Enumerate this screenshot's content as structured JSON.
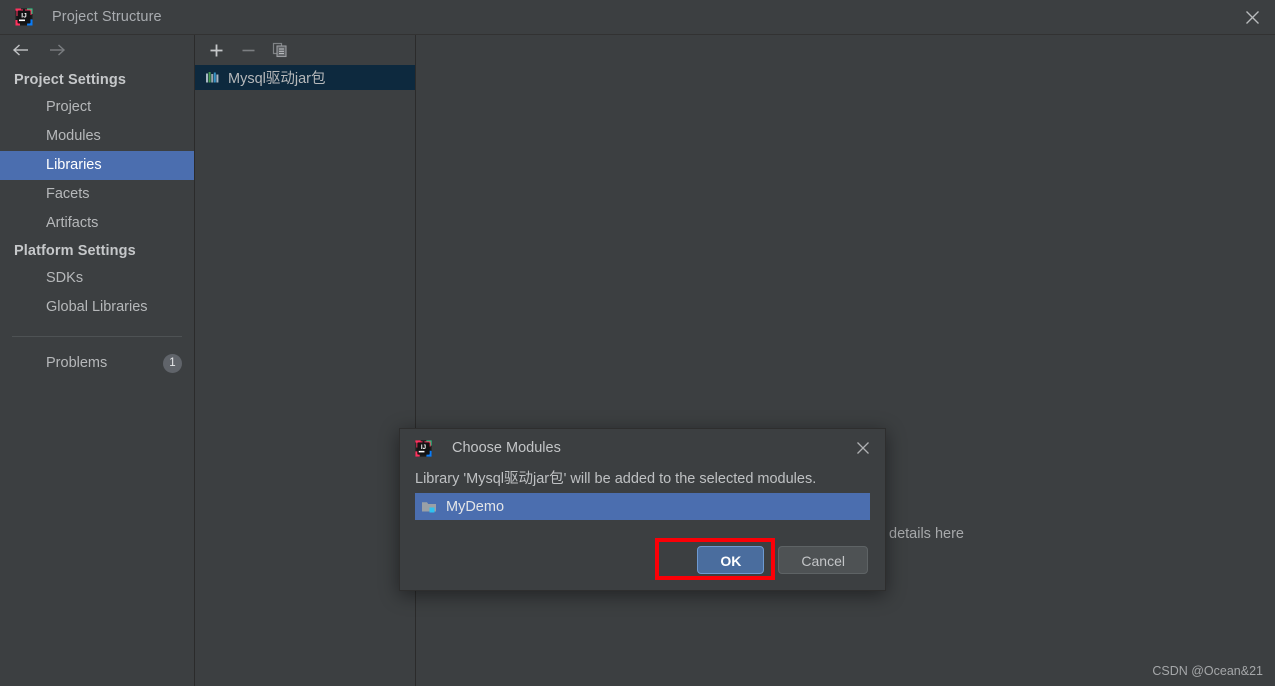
{
  "window": {
    "title": "Project Structure",
    "close_icon": "close-icon",
    "app_icon": "intellij-idea-logo"
  },
  "nav": {
    "back_icon": "arrow-left-icon",
    "forward_icon": "arrow-right-icon"
  },
  "sidebar": {
    "groups": [
      {
        "header": "Project Settings",
        "items": [
          {
            "label": "Project",
            "selected": false
          },
          {
            "label": "Modules",
            "selected": false
          },
          {
            "label": "Libraries",
            "selected": true
          },
          {
            "label": "Facets",
            "selected": false
          },
          {
            "label": "Artifacts",
            "selected": false
          }
        ]
      },
      {
        "header": "Platform Settings",
        "items": [
          {
            "label": "SDKs",
            "selected": false
          },
          {
            "label": "Global Libraries",
            "selected": false
          }
        ]
      }
    ],
    "problems": {
      "label": "Problems",
      "count": "1"
    }
  },
  "library_panel": {
    "toolbar": {
      "add_label": "+",
      "remove_label": "−",
      "copy_icon": "copy-icon"
    },
    "items": [
      {
        "name": "Mysql驱动jar包",
        "icon": "library-icon",
        "selected": true
      }
    ]
  },
  "detail_panel": {
    "hint": "Select a library to edit its details here",
    "watermark": "CSDN @Ocean&21"
  },
  "dialog": {
    "title": "Choose Modules",
    "app_icon": "intellij-idea-logo",
    "close_icon": "close-icon",
    "message": "Library 'Mysql驱动jar包' will be added to the selected modules.",
    "modules": [
      {
        "name": "MyDemo",
        "icon": "module-folder-icon",
        "selected": true
      }
    ],
    "buttons": {
      "ok": "OK",
      "cancel": "Cancel"
    }
  },
  "annotation": {
    "highlight_color": "#fb0007",
    "target": "ok-button"
  },
  "colors": {
    "window_bg": "#3c3f41",
    "selection_blue": "#4b6eaf",
    "inactive_selection": "#0d293e",
    "text": "#bbbbbb",
    "primary_button": "#4a6d9e"
  }
}
